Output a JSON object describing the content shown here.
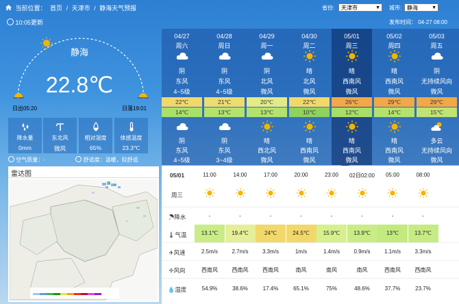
{
  "breadcrumb": {
    "prefix": "当前位置：",
    "home": "首页",
    "sep": "/",
    "city": "天津市",
    "page": "静海天气预报"
  },
  "selectors": {
    "province_label": "省份:",
    "province": "天津市",
    "city_label": "城市:",
    "city": "静海"
  },
  "update": "10:05更新",
  "published": "发布时间： 04-27 08:00",
  "current": {
    "city": "静海",
    "temp": "22.8℃",
    "sunrise": "日出05:20",
    "sunset": "日落19:01",
    "stats": [
      {
        "label": "降水量",
        "value": "0mm",
        "icon": "rain-drops-icon"
      },
      {
        "label": "东北风",
        "value": "微风",
        "icon": "wind-icon"
      },
      {
        "label": "相对湿度",
        "value": "65%",
        "icon": "humidity-icon"
      },
      {
        "label": "体感温度",
        "value": "23.3℃",
        "icon": "thermometer-icon"
      }
    ],
    "air_quality": "空气质量：-",
    "comfort": "舒适度：温暖，较舒适"
  },
  "radar": {
    "title": "雷达图"
  },
  "forecast": [
    {
      "date": "04/27",
      "week": "周六",
      "day_weather": "阴",
      "day_wind_dir": "东风",
      "day_wind_level": "4~5级",
      "hi": "22℃",
      "lo": "14℃",
      "night_weather": "阴",
      "night_wind_dir": "东风",
      "night_wind_level": "4~5级",
      "day_icon": "cloud-icon",
      "night_icon": "cloud-icon",
      "hi_color": "#f2d86a",
      "lo_color": "#a9e06a"
    },
    {
      "date": "04/28",
      "week": "周日",
      "day_weather": "阴",
      "day_wind_dir": "东风",
      "day_wind_level": "4~5级",
      "hi": "21℃",
      "lo": "13℃",
      "night_weather": "阴",
      "night_wind_dir": "东风",
      "night_wind_level": "3~4级",
      "day_icon": "cloud-icon",
      "night_icon": "cloud-icon",
      "hi_color": "#eddc70",
      "lo_color": "#b3e26e"
    },
    {
      "date": "04/29",
      "week": "周一",
      "day_weather": "阴",
      "day_wind_dir": "北风",
      "day_wind_level": "微风",
      "hi": "20℃",
      "lo": "13℃",
      "night_weather": "晴",
      "night_wind_dir": "西北风",
      "night_wind_level": "微风",
      "day_icon": "cloud-icon",
      "night_icon": "sun-icon",
      "hi_color": "#e4ea88",
      "lo_color": "#b3e26e"
    },
    {
      "date": "04/30",
      "week": "周二",
      "day_weather": "晴",
      "day_wind_dir": "北风",
      "day_wind_level": "微风",
      "hi": "22℃",
      "lo": "10℃",
      "night_weather": "晴",
      "night_wind_dir": "西南风",
      "night_wind_level": "微风",
      "day_icon": "sun-icon",
      "night_icon": "sun-icon",
      "hi_color": "#f2d86a",
      "lo_color": "#8fd25e"
    },
    {
      "date": "05/01",
      "week": "周三",
      "day_weather": "晴",
      "day_wind_dir": "西南风",
      "day_wind_level": "微风",
      "hi": "26℃",
      "lo": "12℃",
      "night_weather": "晴",
      "night_wind_dir": "西南风",
      "night_wind_level": "微风",
      "day_icon": "sun-icon",
      "night_icon": "sun-icon",
      "hi_color": "#f0a848",
      "lo_color": "#a6de68"
    },
    {
      "date": "05/02",
      "week": "周四",
      "day_weather": "晴",
      "day_wind_dir": "西南风",
      "day_wind_level": "微风",
      "hi": "29℃",
      "lo": "14℃",
      "night_weather": "晴",
      "night_wind_dir": "西南风",
      "night_wind_level": "微风",
      "day_icon": "sun-icon",
      "night_icon": "sun-icon",
      "hi_color": "#f0a848",
      "lo_color": "#b3e26e"
    },
    {
      "date": "05/03",
      "week": "周五",
      "day_weather": "阴",
      "day_wind_dir": "无持续风向",
      "day_wind_level": "微风",
      "hi": "29℃",
      "lo": "15℃",
      "night_weather": "多云",
      "night_wind_dir": "无持续风向",
      "night_wind_level": "微风",
      "day_icon": "cloud-icon",
      "night_icon": "partly-cloudy-icon",
      "hi_color": "#f0a848",
      "lo_color": "#c0e473"
    }
  ],
  "hourly": {
    "date": "05/01",
    "week": "周三",
    "labels": {
      "precip": "降水",
      "temp": "气温",
      "wind_speed": "风速",
      "wind_dir": "风向",
      "humidity": "湿度"
    },
    "cols": [
      {
        "time": "11:00",
        "precip": "-",
        "temp": "13.1℃",
        "wind_speed": "2.5m/s",
        "wind_dir": "西南风",
        "humidity": "54.9%",
        "temp_color": "#c9ec86"
      },
      {
        "time": "14:00",
        "precip": "-",
        "temp": "19.4℃",
        "wind_speed": "2.7m/s",
        "wind_dir": "西南风",
        "humidity": "38.6%",
        "temp_color": "#e6ee98"
      },
      {
        "time": "17:00",
        "precip": "-",
        "temp": "24℃",
        "wind_speed": "3.3m/s",
        "wind_dir": "西南风",
        "humidity": "17.4%",
        "temp_color": "#f2d86a"
      },
      {
        "time": "20:00",
        "precip": "-",
        "temp": "24.5℃",
        "wind_speed": "1m/s",
        "wind_dir": "南风",
        "humidity": "65.1%",
        "temp_color": "#f2d86a"
      },
      {
        "time": "23:00",
        "precip": "-",
        "temp": "15.9℃",
        "wind_speed": "1.4m/s",
        "wind_dir": "南风",
        "humidity": "75%",
        "temp_color": "#d6f08e"
      },
      {
        "time": "02日02:00",
        "precip": "-",
        "temp": "13.9℃",
        "wind_speed": "0.9m/s",
        "wind_dir": "南风",
        "humidity": "48.6%",
        "temp_color": "#c9ec86"
      },
      {
        "time": "05:00",
        "precip": "-",
        "temp": "13℃",
        "wind_speed": "1.1m/s",
        "wind_dir": "西南风",
        "humidity": "37.7%",
        "temp_color": "#c2ea7e"
      },
      {
        "time": "08:00",
        "precip": "-",
        "temp": "13.7℃",
        "wind_speed": "3.3m/s",
        "wind_dir": "西南风",
        "humidity": "23.7%",
        "temp_color": "#c6eb82"
      }
    ]
  },
  "colors": {
    "panel_blue": "#1c50a0",
    "highlight": "#0a2864",
    "sun": "#f4b400"
  }
}
